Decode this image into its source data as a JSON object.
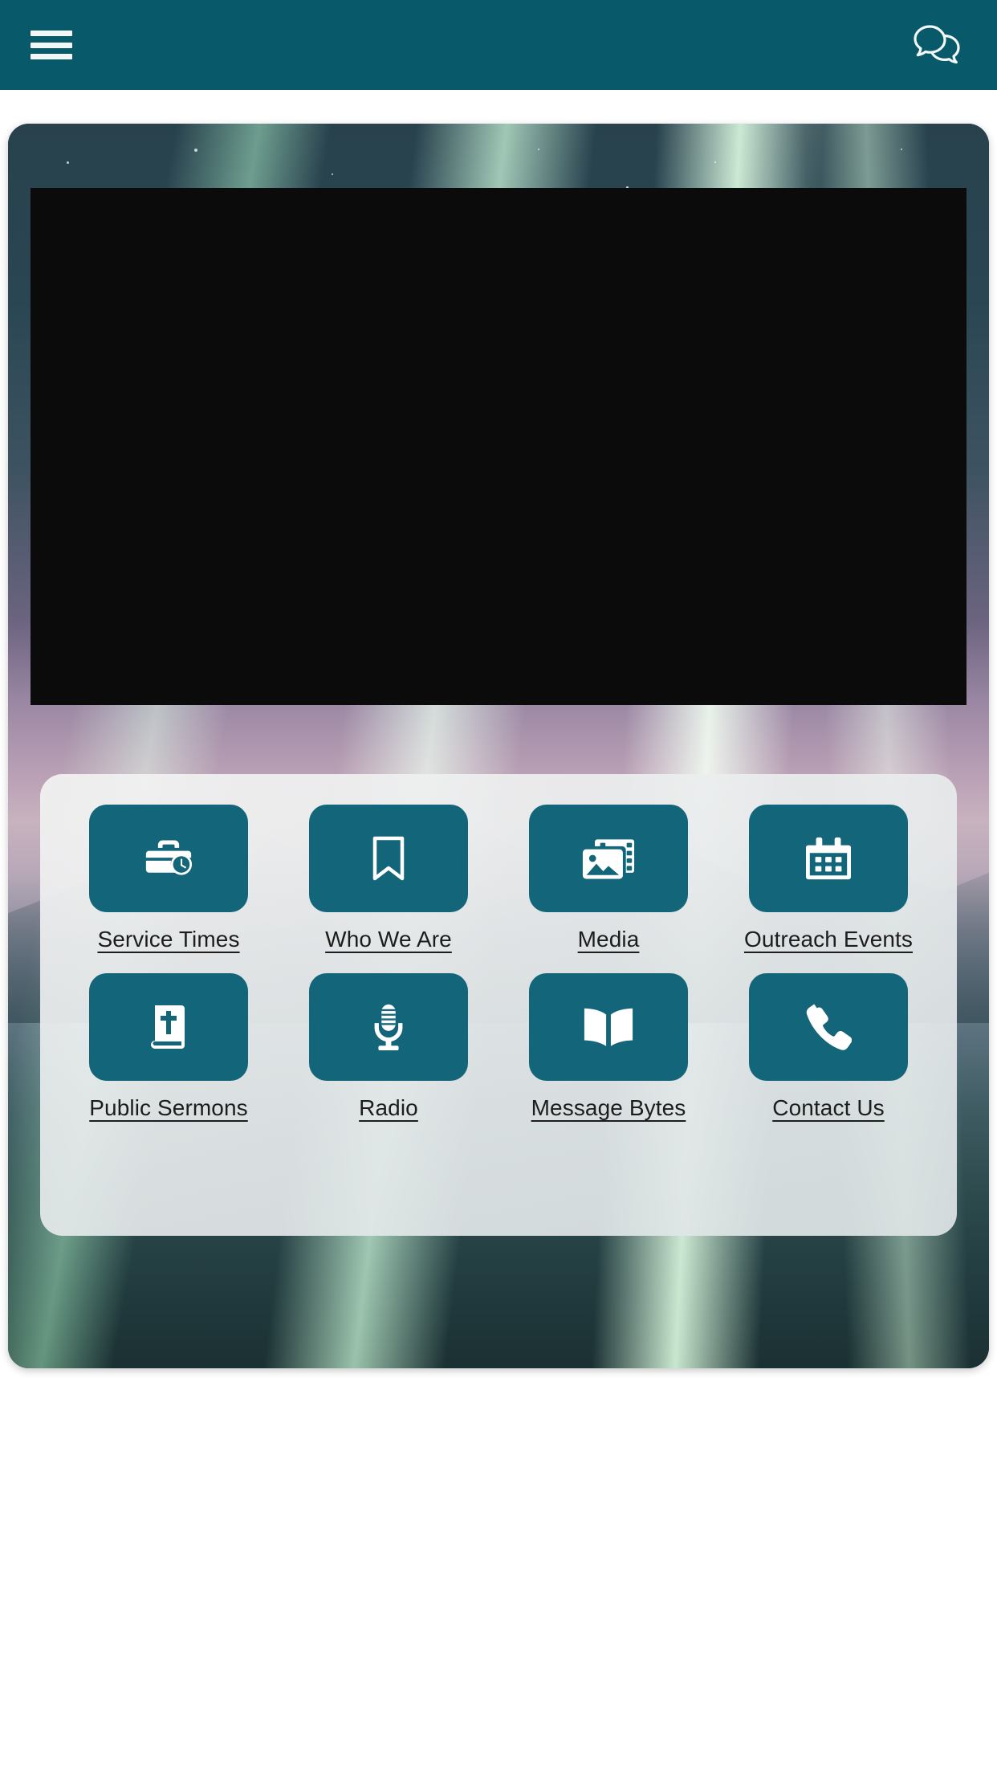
{
  "appbar": {
    "menu_icon": "hamburger-menu-icon",
    "chat_icon": "chat-bubbles-icon",
    "background_color": "#085a6b"
  },
  "hero": {
    "background_description": "aurora-borealis-night-sky",
    "video_player": {
      "state": "loading",
      "background_color": "#0b0b0b"
    }
  },
  "menu": {
    "accent_color": "#13657a",
    "card_background": "#e8ebec",
    "tiles": [
      {
        "icon": "briefcase-clock-icon",
        "label": "Service Times"
      },
      {
        "icon": "bookmark-icon",
        "label": "Who We Are"
      },
      {
        "icon": "photo-film-icon",
        "label": "Media"
      },
      {
        "icon": "calendar-icon",
        "label": "Outreach Events"
      },
      {
        "icon": "bible-icon",
        "label": "Public Sermons"
      },
      {
        "icon": "microphone-icon",
        "label": "Radio"
      },
      {
        "icon": "open-book-icon",
        "label": "Message Bytes"
      },
      {
        "icon": "phone-icon",
        "label": "Contact Us"
      }
    ]
  }
}
